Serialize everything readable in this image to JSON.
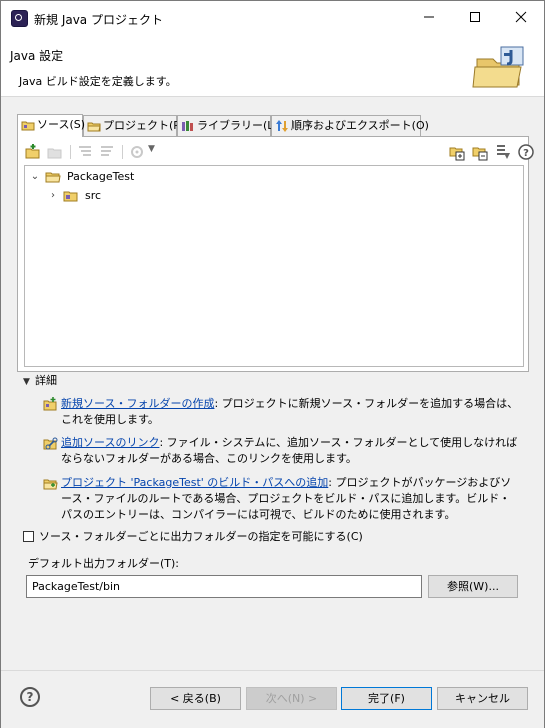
{
  "window": {
    "title": "新規 Java プロジェクト"
  },
  "banner": {
    "title": "Java 設定",
    "description": "Java ビルド設定を定義します。"
  },
  "tabs": [
    {
      "label": "ソース(S)",
      "icon": "source-folder-icon",
      "active": true
    },
    {
      "label": "プロジェクト(P)",
      "icon": "project-folder-icon",
      "active": false
    },
    {
      "label": "ライブラリー(L)",
      "icon": "library-icon",
      "active": false
    },
    {
      "label": "順序およびエクスポート(O)",
      "icon": "order-export-icon",
      "active": false
    }
  ],
  "tree": {
    "root": {
      "label": "PackageTest",
      "expanded": true
    },
    "children": [
      {
        "label": "src",
        "expanded": false
      }
    ]
  },
  "details": {
    "header": "詳細",
    "items": [
      {
        "link": "新規ソース・フォルダーの作成",
        "text": ": プロジェクトに新規ソース・フォルダーを追加する場合は、これを使用します。"
      },
      {
        "link": "追加ソースのリンク",
        "text": ": ファイル・システムに、追加ソース・フォルダーとして使用しなければならないフォルダーがある場合、このリンクを使用します。"
      },
      {
        "link": "プロジェクト 'PackageTest' のビルド・パスへの追加",
        "text": ": プロジェクトがパッケージおよびソース・ファイルのルートである場合、プロジェクトをビルド・パスに追加します。ビルド・パスのエントリーは、コンパイラーには可視で、ビルドのために使用されます。"
      }
    ]
  },
  "options": {
    "per_source_output_label": "ソース・フォルダーごとに出力フォルダーの指定を可能にする(C)",
    "per_source_output_checked": false
  },
  "output": {
    "label": "デフォルト出力フォルダー(T):",
    "value": "PackageTest/bin",
    "browse_label": "参照(W)..."
  },
  "buttons": {
    "back": "< 戻る(B)",
    "next": "次へ(N) >",
    "finish": "完了(F)",
    "cancel": "キャンセル"
  },
  "colors": {
    "link": "#0645ad",
    "primary_border": "#0078d7"
  }
}
